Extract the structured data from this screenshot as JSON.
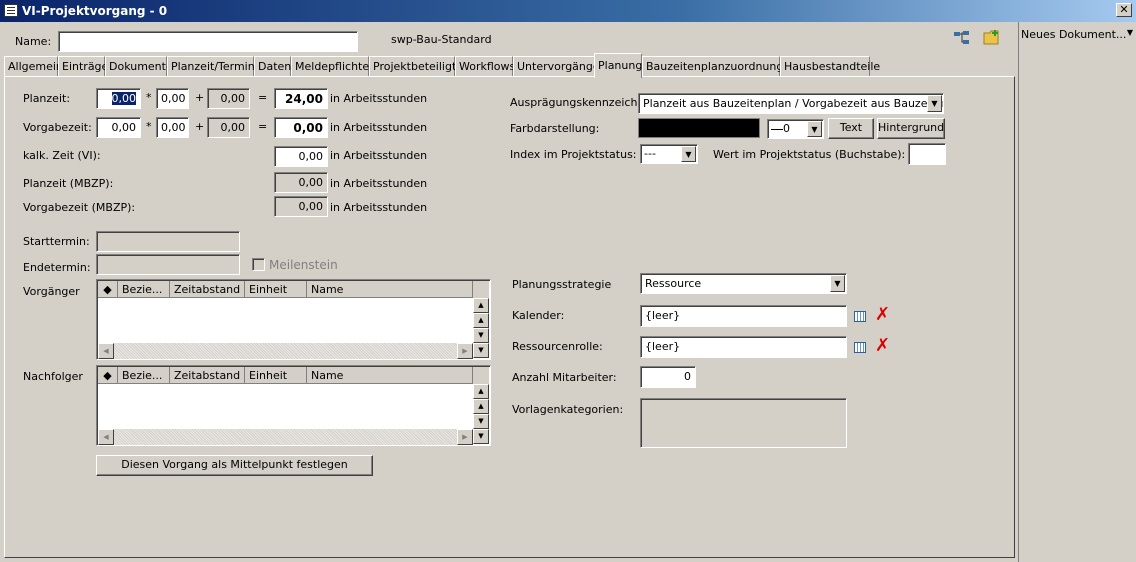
{
  "window": {
    "title": "VI-Projektvorgang - 0",
    "close_label": "✕"
  },
  "header": {
    "name_label": "Name:",
    "name_value": "",
    "template": "swp-Bau-Standard"
  },
  "tabs": [
    "Allgemein",
    "Einträge",
    "Dokumente",
    "Planzeit/Termine",
    "Daten",
    "Meldepflichten",
    "Projektbeteiligte",
    "Workflows",
    "Untervorgänge",
    "Planung",
    "Bauzeitenplanzuordnungen",
    "Hausbestandteile"
  ],
  "active_tab": "Planung",
  "right_pane": {
    "new_document": "Neues Dokument..."
  },
  "times": {
    "planzeit_label": "Planzeit:",
    "planzeit": {
      "a": "0,00",
      "b": "0,00",
      "c": "0,00",
      "result": "24,00"
    },
    "vorgabezeit_label": "Vorgabezeit:",
    "vorgabezeit": {
      "a": "0,00",
      "b": "0,00",
      "c": "0,00",
      "result": "0,00"
    },
    "kalk_label": "kalk. Zeit (VI):",
    "kalk_value": "0,00",
    "planzeit_mbzp_label": "Planzeit (MBZP):",
    "planzeit_mbzp_value": "0,00",
    "vorgabezeit_mbzp_label": "Vorgabezeit (MBZP):",
    "vorgabezeit_mbzp_value": "0,00",
    "unit": "in Arbeitsstunden",
    "op_mul": "*",
    "op_add": "+",
    "op_eq": "="
  },
  "dates": {
    "start_label": "Starttermin:",
    "start_value": "",
    "end_label": "Endetermin:",
    "end_value": "",
    "milestone_label": "Meilenstein"
  },
  "vorgaenger": {
    "label": "Vorgänger",
    "columns": [
      "Bezie...",
      "Zeitabstand",
      "Einheit",
      "Name"
    ]
  },
  "nachfolger": {
    "label": "Nachfolger",
    "columns": [
      "Bezie...",
      "Zeitabstand",
      "Einheit",
      "Name"
    ]
  },
  "center_button": "Diesen Vorgang als Mittelpunkt festlegen",
  "right": {
    "auspraegung_label": "Ausprägungskennzeichen",
    "auspraegung_value": "Planzeit aus Bauzeitenplan / Vorgabezeit aus Bauzeitenplan",
    "farb_label": "Farbdarstellung:",
    "farb_color": "#000000",
    "line_value": "0",
    "text_button": "Text",
    "hintergrund_button": "Hintergrund",
    "index_label": "Index im Projektstatus:",
    "index_value": "---",
    "wert_label": "Wert im Projektstatus (Buchstabe):",
    "wert_value": "",
    "strategie_label": "Planungsstrategie",
    "strategie_value": "Ressource",
    "kalender_label": "Kalender:",
    "kalender_value": "{leer}",
    "rolle_label": "Ressourcenrolle:",
    "rolle_value": "{leer}",
    "mitarbeiter_label": "Anzahl Mitarbeiter:",
    "mitarbeiter_value": "0",
    "vorlagen_label": "Vorlagenkategorien:"
  }
}
